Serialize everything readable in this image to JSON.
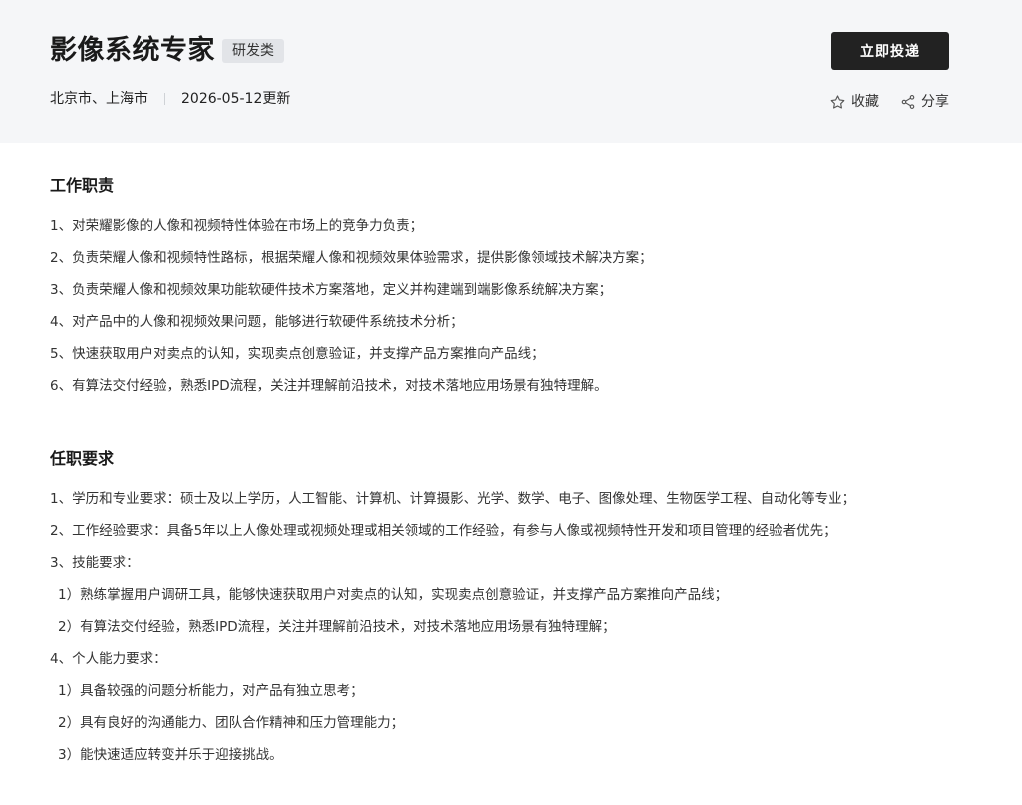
{
  "header": {
    "title": "影像系统专家",
    "category": "研发类",
    "locations": "北京市、上海市",
    "updated": "2026-05-12更新",
    "apply_label": "立即投递",
    "favorite_label": "收藏",
    "share_label": "分享"
  },
  "responsibilities": {
    "title": "工作职责",
    "items": [
      "1、对荣耀影像的人像和视频特性体验在市场上的竞争力负责；",
      "2、负责荣耀人像和视频特性路标，根据荣耀人像和视频效果体验需求，提供影像领域技术解决方案；",
      "3、负责荣耀人像和视频效果功能软硬件技术方案落地，定义并构建端到端影像系统解决方案；",
      "4、对产品中的人像和视频效果问题，能够进行软硬件系统技术分析；",
      "5、快速获取用户对卖点的认知，实现卖点创意验证，并支撑产品方案推向产品线；",
      "6、有算法交付经验，熟悉IPD流程，关注并理解前沿技术，对技术落地应用场景有独特理解。"
    ]
  },
  "requirements": {
    "title": "任职要求",
    "items": [
      "1、学历和专业要求：硕士及以上学历，人工智能、计算机、计算摄影、光学、数学、电子、图像处理、生物医学工程、自动化等专业；",
      "2、工作经验要求：具备5年以上人像处理或视频处理或相关领域的工作经验，有参与人像或视频特性开发和项目管理的经验者优先；",
      "3、技能要求：",
      "1）熟练掌握用户调研工具，能够快速获取用户对卖点的认知，实现卖点创意验证，并支撑产品方案推向产品线；",
      "2）有算法交付经验，熟悉IPD流程，关注并理解前沿技术，对技术落地应用场景有独特理解；",
      "4、个人能力要求：",
      "1）具备较强的问题分析能力，对产品有独立思考；",
      "2）具有良好的沟通能力、团队合作精神和压力管理能力；",
      "3）能快速适应转变并乐于迎接挑战。"
    ]
  },
  "icons": {
    "favorite": "star-outline-icon",
    "share": "share-nodes-icon"
  },
  "colors": {
    "header_bg": "#f5f6f8",
    "button_bg": "#222222",
    "tag_bg": "#e2e4e8"
  }
}
